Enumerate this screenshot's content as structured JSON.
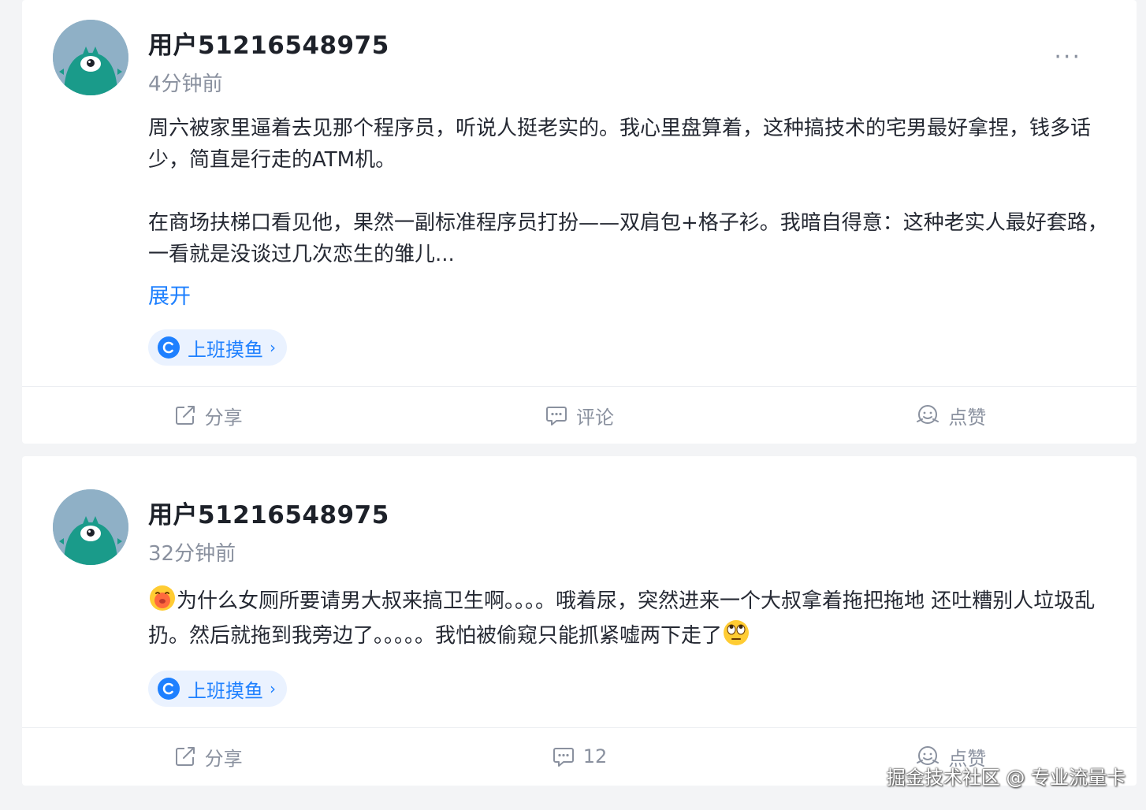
{
  "colors": {
    "accent": "#1e80ff",
    "text": "#252933",
    "muted": "#8a919f",
    "background": "#f3f4f6"
  },
  "posts": [
    {
      "username": "用户51216548975",
      "time": "4分钟前",
      "more_label": "···",
      "paragraphs": [
        "周六被家里逼着去见那个程序员，听说人挺老实的。我心里盘算着，这种搞技术的宅男最好拿捏，钱多话少，简直是行走的ATM机。",
        "在商场扶梯口看见他，果然一副标准程序员打扮——双肩包+格子衫。我暗自得意：这种老实人最好套路，一看就是没谈过几次恋生的雏儿..."
      ],
      "expand_label": "展开",
      "tag": {
        "label": "上班摸鱼",
        "icon": "juejin-circle-icon"
      },
      "actions": {
        "share": "分享",
        "comment": "评论",
        "like": "点赞"
      }
    },
    {
      "username": "用户51216548975",
      "time": "32分钟前",
      "content": {
        "lead_emoji": "face-with-pout-emoji",
        "text": "为什么女厕所要请男大叔来搞卫生啊。。。。哦着尿，突然进来一个大叔拿着拖把拖地 还吐糟别人垃圾乱扔。然后就拖到我旁边了。。。。。我怕被偷窥只能抓紧嘘两下走了",
        "trail_emoji": "eye-roll-emoji"
      },
      "tag": {
        "label": "上班摸鱼",
        "icon": "juejin-circle-icon"
      },
      "actions": {
        "share": "分享",
        "comment": "12",
        "like": "点赞"
      }
    }
  ],
  "watermark": "掘金技术社区 @ 专业流量卡"
}
